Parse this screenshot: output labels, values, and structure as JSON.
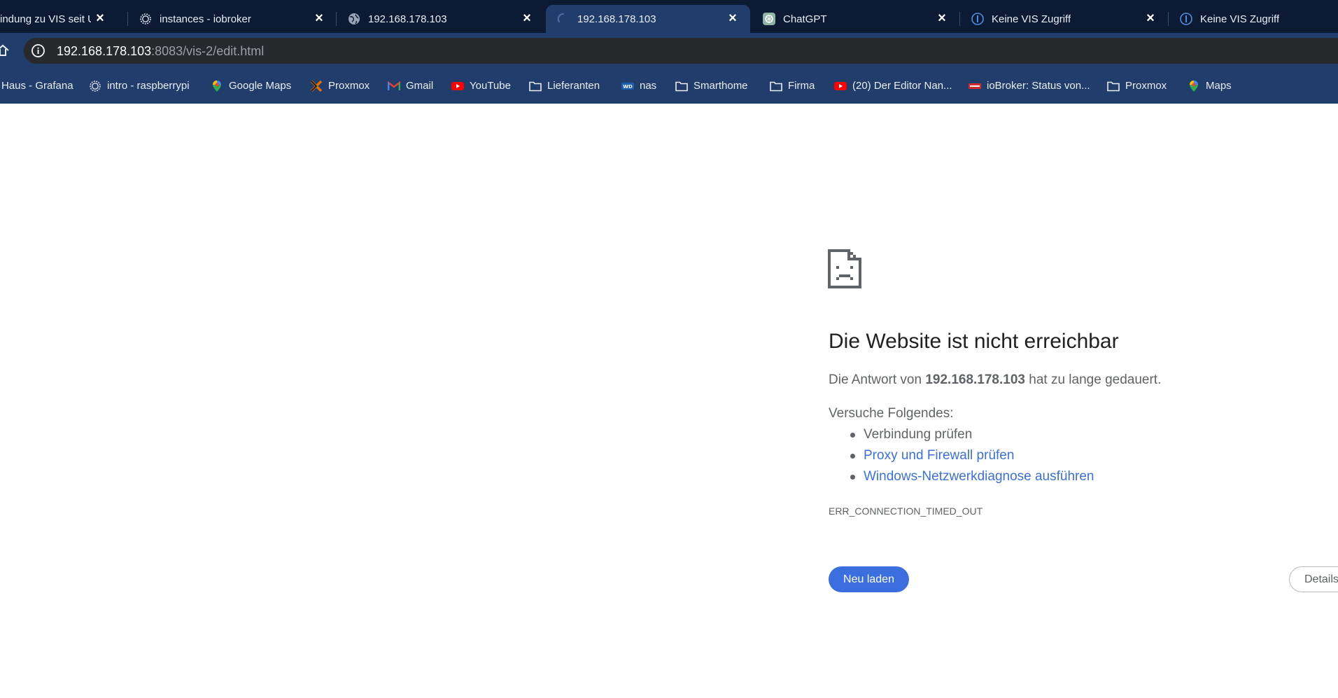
{
  "tabs": [
    {
      "title": "indung zu VIS seit Up",
      "icon": "none",
      "active": false
    },
    {
      "title": "instances - iobroker",
      "icon": "iobroker-gear-icon",
      "active": false
    },
    {
      "title": "192.168.178.103",
      "icon": "globe-icon",
      "active": false
    },
    {
      "title": "192.168.178.103",
      "icon": "loading-spinner-icon",
      "active": true
    },
    {
      "title": "ChatGPT",
      "icon": "chatgpt-icon",
      "active": false
    },
    {
      "title": "Keine VIS Zugriff",
      "icon": "iobroker-info-icon",
      "active": false
    },
    {
      "title": "Keine VIS Zugriff",
      "icon": "iobroker-info-icon",
      "active": false
    }
  ],
  "address_bar": {
    "host": "192.168.178.103",
    "path": ":8083/vis-2/edit.html"
  },
  "bookmarks": [
    {
      "label": "Haus - Grafana",
      "icon": "none"
    },
    {
      "label": "intro - raspberrypi",
      "icon": "iobroker-gear-icon"
    },
    {
      "label": "Google Maps",
      "icon": "maps-pin-icon"
    },
    {
      "label": "Proxmox",
      "icon": "proxmox-icon"
    },
    {
      "label": "Gmail",
      "icon": "gmail-icon"
    },
    {
      "label": "YouTube",
      "icon": "youtube-icon"
    },
    {
      "label": "Lieferanten",
      "icon": "folder-icon"
    },
    {
      "label": "nas",
      "icon": "wd-icon"
    },
    {
      "label": "Smarthome",
      "icon": "folder-icon"
    },
    {
      "label": "Firma",
      "icon": "folder-icon"
    },
    {
      "label": "(20) Der Editor Nan...",
      "icon": "youtube-icon"
    },
    {
      "label": "ioBroker: Status von...",
      "icon": "iobroker-red-icon"
    },
    {
      "label": "Proxmox",
      "icon": "folder-icon"
    },
    {
      "label": "Maps",
      "icon": "maps-pin-icon"
    }
  ],
  "error_page": {
    "title": "Die Website ist nicht erreichbar",
    "subtitle_prefix": "Die Antwort von ",
    "subtitle_host": "192.168.178.103",
    "subtitle_suffix": " hat zu lange gedauert.",
    "try_label": "Versuche Folgendes:",
    "suggestions": [
      {
        "text": "Verbindung prüfen",
        "is_link": false
      },
      {
        "text": "Proxy und Firewall prüfen",
        "is_link": true
      },
      {
        "text": "Windows-Netzwerkdiagnose ausführen",
        "is_link": true
      }
    ],
    "error_code": "ERR_CONNECTION_TIMED_OUT",
    "reload_label": "Neu laden",
    "details_label": "Details"
  },
  "colors": {
    "tab_strip": "#0c1a34",
    "toolbar": "#213d6b",
    "omnibox": "#27292d",
    "link": "#3b6fe0",
    "primary_button": "#3b6fe0"
  }
}
